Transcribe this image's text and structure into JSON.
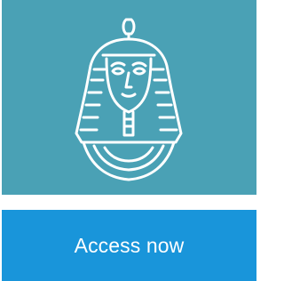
{
  "colors": {
    "hero_background": "#4aa1b5",
    "icon_stroke": "#ffffff",
    "icon_fill": "#ffffff",
    "button_background": "#1995da",
    "button_text": "#ffffff"
  },
  "hero": {
    "icon": "pharaoh-mask-icon"
  },
  "button": {
    "label": "Access now"
  }
}
